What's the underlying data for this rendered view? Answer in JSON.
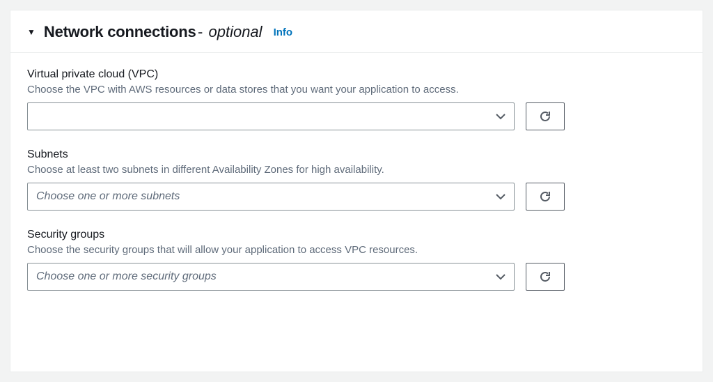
{
  "section": {
    "title": "Network connections",
    "optional_label": "optional",
    "info_label": "Info"
  },
  "fields": {
    "vpc": {
      "label": "Virtual private cloud (VPC)",
      "description": "Choose the VPC with AWS resources or data stores that you want your application to access.",
      "placeholder": ""
    },
    "subnets": {
      "label": "Subnets",
      "description": "Choose at least two subnets in different Availability Zones for high availability.",
      "placeholder": "Choose one or more subnets"
    },
    "security_groups": {
      "label": "Security groups",
      "description": "Choose the security groups that will allow your application to access VPC resources.",
      "placeholder": "Choose one or more security groups"
    }
  }
}
